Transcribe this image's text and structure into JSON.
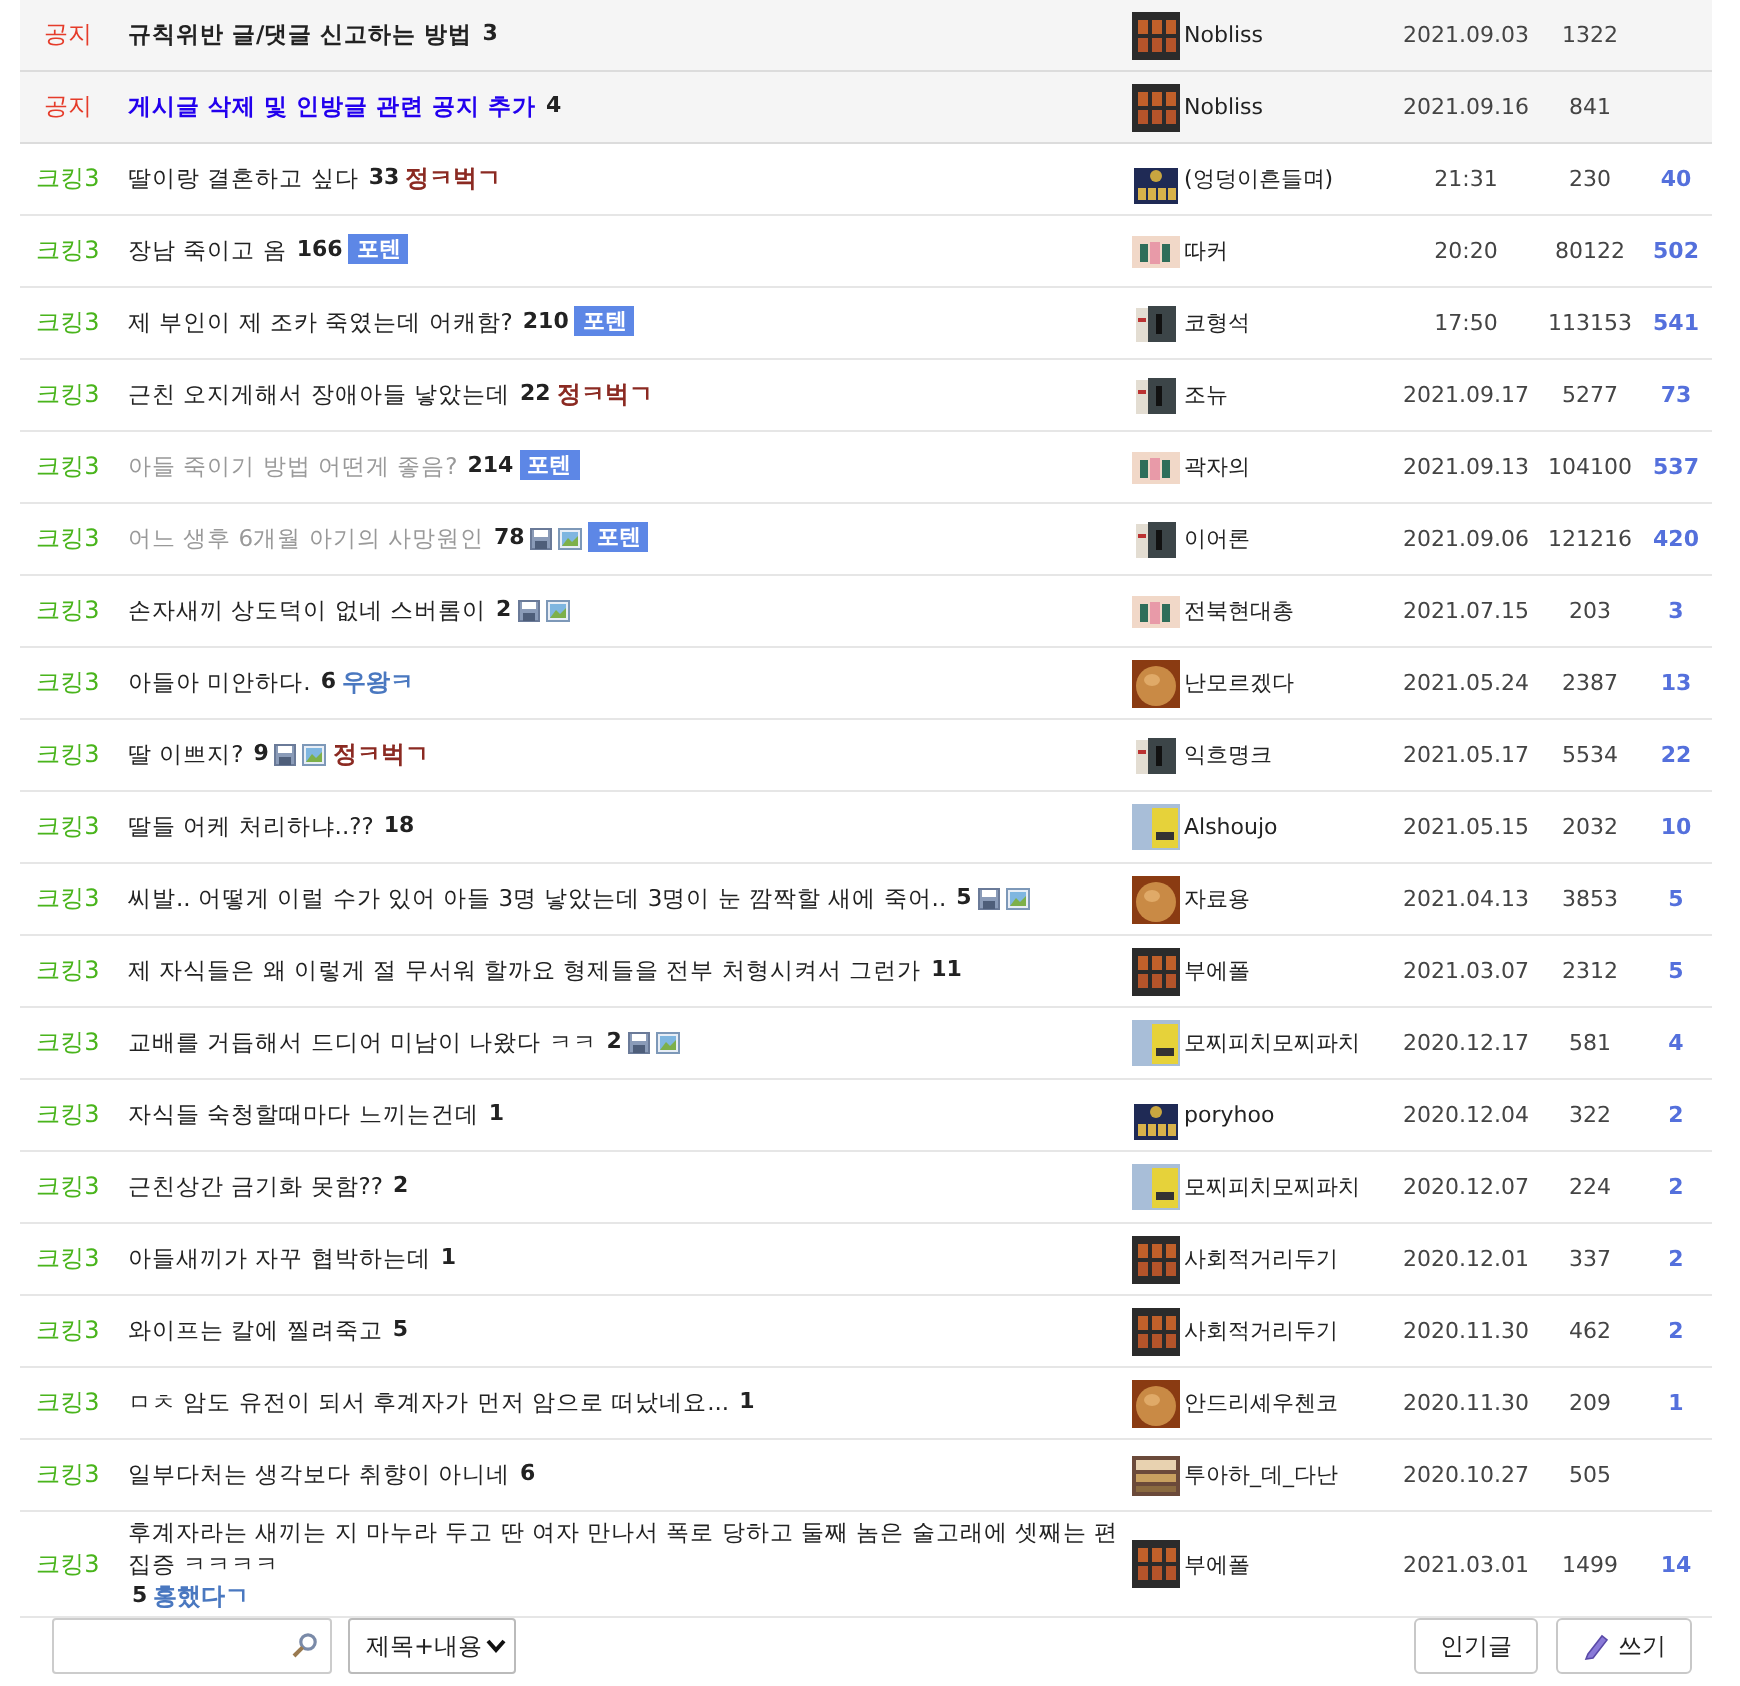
{
  "posts": [
    {
      "kind": "notice",
      "category": "공지",
      "title": "규칙위반 글/댓글 신고하는 방법",
      "comments": "3",
      "author": "Nobliss",
      "date": "2021.09.03",
      "views": "1322"
    },
    {
      "kind": "notice",
      "category": "공지",
      "title": "게시글 삭제 및 인방글 관련 공지 추가",
      "color": "#2200ee",
      "comments": "4",
      "author": "Nobliss",
      "date": "2021.09.16",
      "views": "841"
    },
    {
      "kind": "post",
      "category": "크킹3",
      "title": "딸이랑 결혼하고 싶다",
      "comments": "33",
      "badge": {
        "kind": "dccon",
        "text": "정ㅋ벅ㄱ",
        "color": "#8b2a22"
      },
      "author": "(엉덩이흔들며)",
      "date": "21:31",
      "views": "230",
      "recommend": "40"
    },
    {
      "kind": "post",
      "category": "크킹3",
      "title": "장남 죽이고 옴",
      "comments": "166",
      "badge": {
        "kind": "potent",
        "text": "포텐"
      },
      "author": "따커",
      "date": "20:20",
      "views": "80122",
      "recommend": "502"
    },
    {
      "kind": "post",
      "category": "크킹3",
      "title": "제 부인이 제 조카 죽였는데 어캐함?",
      "comments": "210",
      "badge": {
        "kind": "potent",
        "text": "포텐"
      },
      "author": "코형석",
      "date": "17:50",
      "views": "113153",
      "recommend": "541"
    },
    {
      "kind": "post",
      "category": "크킹3",
      "title": "근친 오지게해서 장애아들 낳았는데",
      "comments": "22",
      "badge": {
        "kind": "dccon",
        "text": "정ㅋ벅ㄱ",
        "color": "#8b2a22"
      },
      "author": "조뉴",
      "date": "2021.09.17",
      "views": "5277",
      "recommend": "73"
    },
    {
      "kind": "post",
      "category": "크킹3",
      "title": "아들 죽이기 방법 어떤게 좋음?",
      "visited": true,
      "comments": "214",
      "badge": {
        "kind": "potent",
        "text": "포텐"
      },
      "author": "곽자의",
      "date": "2021.09.13",
      "views": "104100",
      "recommend": "537"
    },
    {
      "kind": "post",
      "category": "크킹3",
      "title": "어느 생후 6개월 아기의 사망원인",
      "visited": true,
      "comments": "78",
      "attachments": true,
      "badge": {
        "kind": "potent",
        "text": "포텐"
      },
      "author": "이어론",
      "date": "2021.09.06",
      "views": "121216",
      "recommend": "420"
    },
    {
      "kind": "post",
      "category": "크킹3",
      "title": "손자새끼 상도덕이 없네 스버롬이",
      "comments": "2",
      "attachments": true,
      "author": "전북현대총",
      "date": "2021.07.15",
      "views": "203",
      "recommend": "3"
    },
    {
      "kind": "post",
      "category": "크킹3",
      "title": "아들아 미안하다.",
      "comments": "6",
      "badge": {
        "kind": "dccon",
        "text": "우왕ㅋ",
        "color": "#4a78c0"
      },
      "author": "난모르겠다",
      "date": "2021.05.24",
      "views": "2387",
      "recommend": "13"
    },
    {
      "kind": "post",
      "category": "크킹3",
      "title": "딸 이쁘지?",
      "comments": "9",
      "attachments": true,
      "badge": {
        "kind": "dccon",
        "text": "정ㅋ벅ㄱ",
        "color": "#8b2a22"
      },
      "author": "익흐명크",
      "date": "2021.05.17",
      "views": "5534",
      "recommend": "22"
    },
    {
      "kind": "post",
      "category": "크킹3",
      "title": "딸들 어케 처리하냐..??",
      "comments": "18",
      "author": "Alshoujo",
      "date": "2021.05.15",
      "views": "2032",
      "recommend": "10"
    },
    {
      "kind": "post",
      "category": "크킹3",
      "title": "씨발.. 어떻게 이럴 수가 있어 아들 3명 낳았는데 3명이 눈 깜짝할 새에 죽어..",
      "comments": "5",
      "attachments": true,
      "author": "자료용",
      "date": "2021.04.13",
      "views": "3853",
      "recommend": "5"
    },
    {
      "kind": "post",
      "category": "크킹3",
      "title": "제 자식들은 왜 이렇게 절 무서워 할까요 형제들을 전부 처형시켜서 그런가",
      "comments": "11",
      "author": "부에폴",
      "date": "2021.03.07",
      "views": "2312",
      "recommend": "5"
    },
    {
      "kind": "post",
      "category": "크킹3",
      "title": "교배를 거듭해서 드디어 미남이 나왔다 ㅋㅋ",
      "comments": "2",
      "attachments": true,
      "author": "모찌피치모찌파치",
      "date": "2020.12.17",
      "views": "581",
      "recommend": "4"
    },
    {
      "kind": "post",
      "category": "크킹3",
      "title": "자식들 숙청할때마다 느끼는건데",
      "comments": "1",
      "author": "poryhoo",
      "date": "2020.12.04",
      "views": "322",
      "recommend": "2"
    },
    {
      "kind": "post",
      "category": "크킹3",
      "title": "근친상간 금기화 못함??",
      "comments": "2",
      "author": "모찌피치모찌파치",
      "date": "2020.12.07",
      "views": "224",
      "recommend": "2"
    },
    {
      "kind": "post",
      "category": "크킹3",
      "title": "아들새끼가 자꾸 협박하는데",
      "comments": "1",
      "author": "사회적거리두기",
      "date": "2020.12.01",
      "views": "337",
      "recommend": "2"
    },
    {
      "kind": "post",
      "category": "크킹3",
      "title": "와이프는 칼에 찔려죽고",
      "comments": "5",
      "author": "사회적거리두기",
      "date": "2020.11.30",
      "views": "462",
      "recommend": "2"
    },
    {
      "kind": "post",
      "category": "크킹3",
      "title": "ㅁㅊ 암도 유전이 되서 후계자가 먼저 암으로 떠났네요...",
      "comments": "1",
      "author": "안드리셰우첸코",
      "date": "2020.11.30",
      "views": "209",
      "recommend": "1"
    },
    {
      "kind": "post",
      "category": "크킹3",
      "title": "일부다처는 생각보다 취향이 아니네",
      "comments": "6",
      "author": "투아하_데_다난",
      "date": "2020.10.27",
      "views": "505"
    },
    {
      "kind": "post",
      "category": "크킹3",
      "title": "후계자라는 새끼는 지 마누라 두고 딴 여자 만나서 폭로 당하고 둘째 놈은 술고래에 셋째는 편집증 ㅋㅋㅋㅋ",
      "comments": "5",
      "badge": {
        "kind": "dccon",
        "text": "홍했다ㄱ",
        "color": "#4a78c0"
      },
      "author": "부에폴",
      "date": "2021.03.01",
      "views": "1499",
      "recommend": "14"
    }
  ],
  "search": {
    "scope": "제목+내용"
  },
  "buttons": [
    {
      "kind": "plain",
      "label": "인기글"
    },
    {
      "kind": "write",
      "label": "쓰기"
    }
  ]
}
